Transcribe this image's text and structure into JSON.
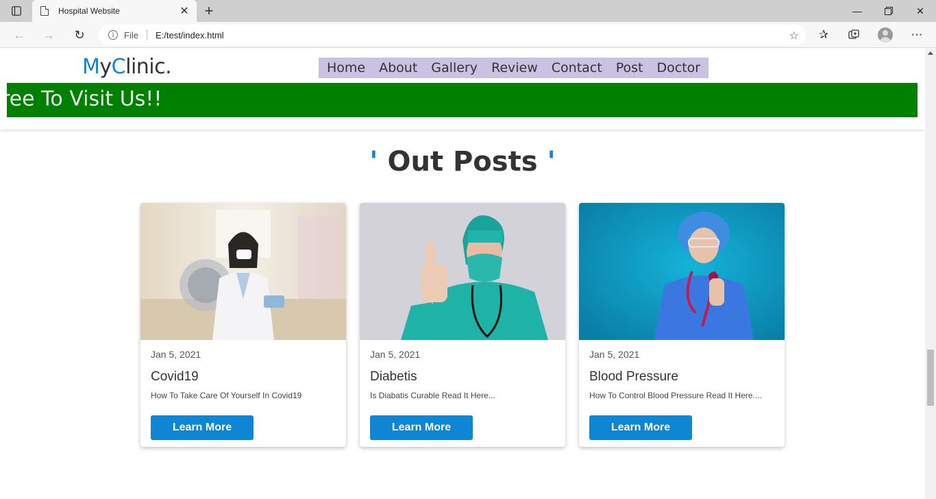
{
  "browser": {
    "tab_title": "Hospital Website",
    "address_scheme": "File",
    "address_url": "E:/test/index.html"
  },
  "site": {
    "logo_part1": "M",
    "logo_part2": "y",
    "logo_part3": "C",
    "logo_part4": "linic.",
    "nav": [
      "Home",
      "About",
      "Gallery",
      "Review",
      "Contact",
      "Post",
      "Doctor"
    ],
    "marquee_text": "ree To Visit Us!!",
    "section_title_quote_open": "'",
    "section_title": " Out Posts ",
    "section_title_quote_close": "'"
  },
  "posts": [
    {
      "date": "Jan 5, 2021",
      "title": "Covid19",
      "desc": "How To Take Care Of Yourself In Covid19",
      "button": "Learn More"
    },
    {
      "date": "Jan 5, 2021",
      "title": "Diabetis",
      "desc": "Is Diabatis Curable Read It Here...",
      "button": "Learn More"
    },
    {
      "date": "Jan 5, 2021",
      "title": "Blood Pressure",
      "desc": "How To Control Blood Pressure Read It Here....",
      "button": "Learn More"
    }
  ],
  "colors": {
    "accent": "#0e86d4",
    "nav_bg": "#c9c2e2",
    "marquee_bg": "#008000"
  }
}
